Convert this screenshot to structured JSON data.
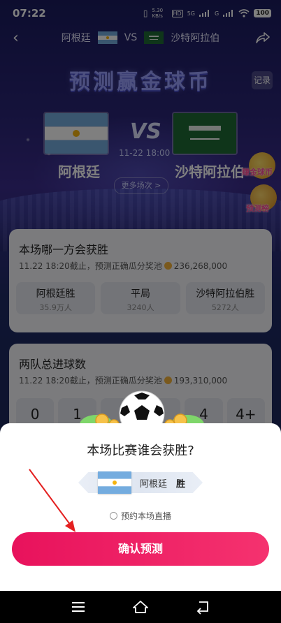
{
  "status_bar": {
    "time": "07:22",
    "net_speed": "5.30 KB/s",
    "hd_label": "HD",
    "signal1_label": "5G",
    "signal2_label": "G",
    "battery": "100"
  },
  "header": {
    "team_left": "阿根廷",
    "vs": "VS",
    "team_right": "沙特阿拉伯"
  },
  "banner": {
    "title": "预测赢金球币",
    "record": "记录",
    "vs": "VS",
    "match_time": "11-22 18:00",
    "team_left": "阿根廷",
    "team_right": "沙特阿拉伯",
    "more_matches": "更多场次 >",
    "side_earn": "赚金球币",
    "side_rank": "预测榜"
  },
  "winner_card": {
    "title": "本场哪一方会获胜",
    "subtitle_prefix": "11.22 18:20截止，预测正确瓜分奖池",
    "pool": "236,268,000",
    "options": [
      {
        "label": "阿根廷胜",
        "count": "35.9万人"
      },
      {
        "label": "平局",
        "count": "3240人"
      },
      {
        "label": "沙特阿拉伯胜",
        "count": "5272人"
      }
    ]
  },
  "goals_card": {
    "title": "两队总进球数",
    "subtitle_prefix": "11.22 18:20截止，预测正确瓜分奖池",
    "pool": "193,310,000",
    "scores": [
      "0",
      "1",
      "",
      "",
      "4",
      "4+"
    ]
  },
  "sheet": {
    "title": "本场比赛谁会获胜?",
    "pick_team": "阿根廷",
    "pick_result": "胜",
    "reserve_label": "预约本场直播",
    "confirm_label": "确认预测"
  },
  "colors": {
    "accent": "#f0245f",
    "argentina_blue": "#74acdf",
    "saudi_green": "#1f6b34"
  }
}
